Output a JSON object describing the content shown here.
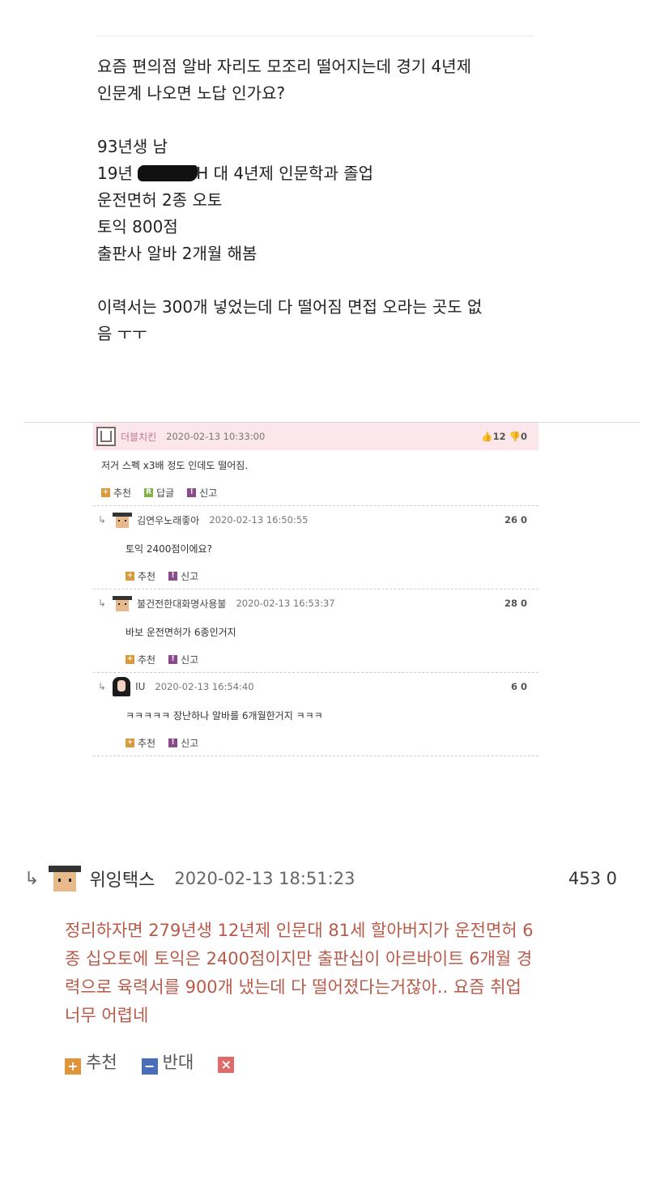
{
  "post": {
    "title_line1": "요즘 편의점 알바 자리도 모조리 떨어지는데 경기 4년제",
    "title_line2": "인문계 나오면 노답 인가요?",
    "line_birth": "93년생 남",
    "line_grad_prefix": "19년",
    "line_grad_suffix": "H 대 4년제 인문학과 졸업",
    "line_license": "운전면허 2종 오토",
    "line_toeic": "토익 800점",
    "line_job": "출판사 알바 2개월 해봄",
    "line_resume1": "이력서는 300개 넣었는데 다 떨어짐 면접 오라는 곳도 없",
    "line_resume2": "음 ㅜㅜ"
  },
  "thread": {
    "top": {
      "name": "더블치킨",
      "date": "2020-02-13 10:33:00",
      "votes": "👍12 👎0",
      "body": "저거 스펙 x3배 정도 인데도 떨어짐.",
      "recommend": "추천",
      "reply": "답글",
      "report": "신고"
    },
    "replies": [
      {
        "name": "김연우노래좋아",
        "date": "2020-02-13 16:50:55",
        "votes": "26 0",
        "body": "토익 2400점이에요?",
        "recommend": "추천",
        "report": "신고"
      },
      {
        "name": "불건전한대화명사용불",
        "date": "2020-02-13 16:53:37",
        "votes": "28 0",
        "body": "바보 운전면허가 6종인거지",
        "recommend": "추천",
        "report": "신고"
      },
      {
        "name": "IU",
        "date": "2020-02-13 16:54:40",
        "votes": "6 0",
        "body": "ㅋㅋㅋㅋㅋ 장난하나 알바를 6개월한거지 ㅋㅋㅋ",
        "recommend": "추천",
        "report": "신고"
      }
    ]
  },
  "big_comment": {
    "arrow": "↳",
    "name": "위잉택스",
    "date": "2020-02-13 18:51:23",
    "votes": "453 0",
    "body_line1": "정리하자면 279년생 12년제 인문대 81세 할아버지가 운전면허 6",
    "body_line2": "종 십오토에 토익은 2400점이지만 출판십이 아르바이트 6개월 경",
    "body_line3": "력으로 육력서를 900개 냈는데 다 떨어졌다는거잖아.. 요즘 취업",
    "body_line4": "너무 어렵네",
    "recommend": "추천",
    "oppose": "반대"
  }
}
